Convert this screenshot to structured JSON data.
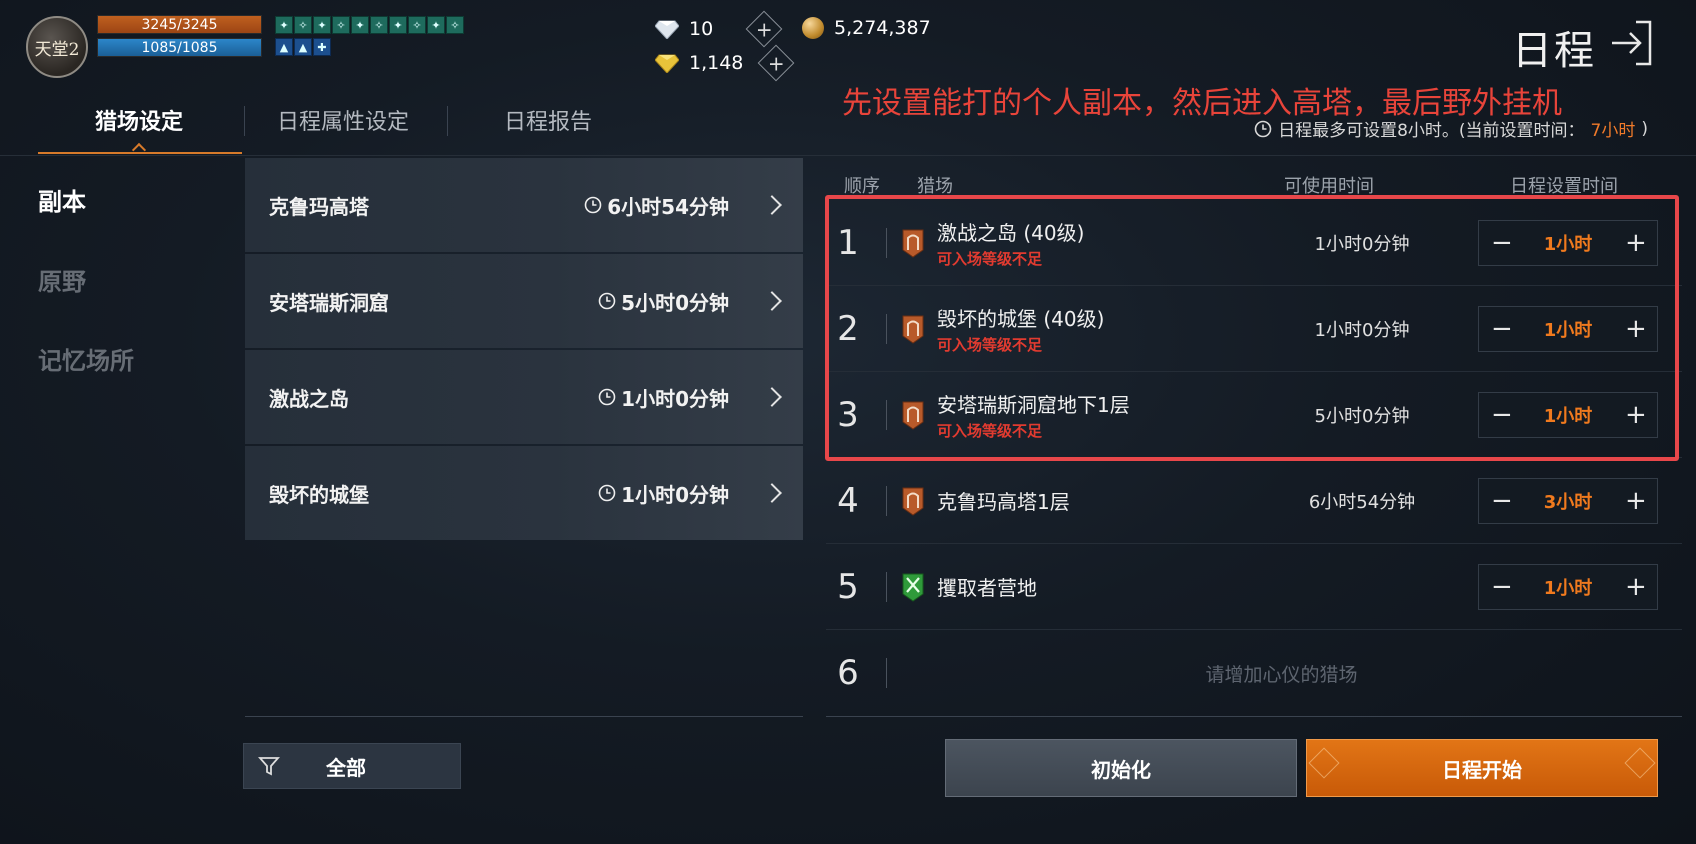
{
  "logo": {
    "text": "天堂2"
  },
  "stats": {
    "hp": "3245/3245",
    "mp": "1085/1085"
  },
  "currency": {
    "diamond": "10",
    "gold_gem": "1,148",
    "adena": "5,274,387"
  },
  "header": {
    "title": "日程",
    "annotation": "先设置能打的个人副本，然后进入高塔，最后野外挂机",
    "limit_note_prefix": "日程最多可设置8小时。(当前设置时间：",
    "limit_note_value": "7小时",
    "limit_note_suffix": ")"
  },
  "tabs": [
    {
      "label": "猎场设定"
    },
    {
      "label": "日程属性设定"
    },
    {
      "label": "日程报告"
    }
  ],
  "categories": [
    {
      "label": "副本"
    },
    {
      "label": "原野"
    },
    {
      "label": "记忆场所"
    }
  ],
  "dungeons": [
    {
      "name": "克鲁玛高塔",
      "time": "6小时54分钟"
    },
    {
      "name": "安塔瑞斯洞窟",
      "time": "5小时0分钟"
    },
    {
      "name": "激战之岛",
      "time": "1小时0分钟"
    },
    {
      "name": "毁坏的城堡",
      "time": "1小时0分钟"
    }
  ],
  "filter": {
    "label": "全部"
  },
  "table_headers": {
    "order": "顺序",
    "field": "猎场",
    "available": "可使用时间",
    "set_time": "日程设置时间"
  },
  "schedule": [
    {
      "num": "1",
      "name": "激战之岛 (40级)",
      "warning": "可入场等级不足",
      "available": "1小时0分钟",
      "set": "1小时",
      "icon": "dungeon-icon"
    },
    {
      "num": "2",
      "name": "毁坏的城堡 (40级)",
      "warning": "可入场等级不足",
      "available": "1小时0分钟",
      "set": "1小时",
      "icon": "dungeon-icon"
    },
    {
      "num": "3",
      "name": "安塔瑞斯洞窟地下1层",
      "warning": "可入场等级不足",
      "available": "5小时0分钟",
      "set": "1小时",
      "icon": "dungeon-icon"
    },
    {
      "num": "4",
      "name": "克鲁玛高塔1层",
      "warning": "",
      "available": "6小时54分钟",
      "set": "3小时",
      "icon": "dungeon-icon"
    },
    {
      "num": "5",
      "name": "攫取者营地",
      "warning": "",
      "available": "",
      "set": "1小时",
      "icon": "field-icon"
    },
    {
      "num": "6",
      "placeholder": "请增加心仪的猎场"
    }
  ],
  "buttons": {
    "reset": "初始化",
    "start": "日程开始"
  },
  "colors": {
    "accent": "#d77a2a",
    "warning": "#e23b30",
    "highlight": "#e8474a",
    "start_button": "#e27516"
  }
}
